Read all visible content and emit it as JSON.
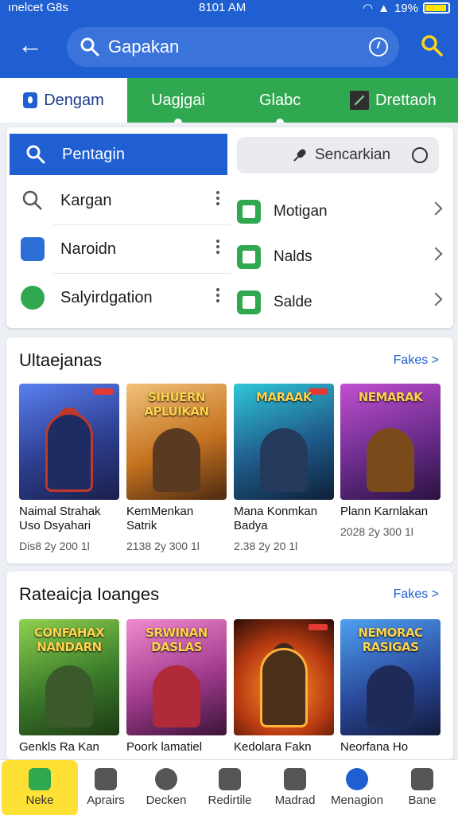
{
  "status_bar": {
    "carrier": "ınelcet G8s",
    "time": "8101 AM",
    "battery": "19%"
  },
  "header": {
    "search_placeholder": "Gapakan"
  },
  "tabs": [
    {
      "label": "Dengam"
    },
    {
      "label": "Uagjgai"
    },
    {
      "label": "Glabc"
    },
    {
      "label": "Drettaoh"
    }
  ],
  "quick": {
    "primary_label": "Pentagin",
    "secondary_label": "Sencarkian",
    "left_items": [
      {
        "label": "Kargan"
      },
      {
        "label": "Naroidn"
      },
      {
        "label": "Salyirdgation"
      }
    ],
    "right_items": [
      {
        "label": "Motigan"
      },
      {
        "label": "Nalds"
      },
      {
        "label": "Salde"
      }
    ]
  },
  "section1": {
    "title": "Ultaejanas",
    "more": "Fakes >",
    "cards": [
      {
        "logo": "",
        "name": "Naimal Strahak Uso Dsyahari",
        "meta": "Dis8 2y 200 1l"
      },
      {
        "logo": "SIHUERN APLUIKAN",
        "name": "KemMenkan Satrik",
        "meta": "2138 2y 300 1l"
      },
      {
        "logo": "MARAAK",
        "name": "Mana Konmkan Badya",
        "meta": "2.38 2y 20 1l"
      },
      {
        "logo": "NEMARAK",
        "name": "Plann Karnlakan",
        "meta": "2028 2y 300 1l"
      }
    ]
  },
  "section2": {
    "title": "Rateaicja Ioanges",
    "more": "Fakes >",
    "cards": [
      {
        "logo": "CONFAHAX NANDARN",
        "name": "Genkls Ra Kan"
      },
      {
        "logo": "SRWINAN DASLAS",
        "name": "Poork lamatiel"
      },
      {
        "logo": "",
        "name": "Kedolara Fakn"
      },
      {
        "logo": "NEMORAC RASIGAS",
        "name": "Neorfana Ho"
      }
    ]
  },
  "nav": [
    {
      "label": "Neke"
    },
    {
      "label": "Aprairs"
    },
    {
      "label": "Decken"
    },
    {
      "label": "Redirtile"
    },
    {
      "label": "Madrad"
    },
    {
      "label": "Menagion"
    },
    {
      "label": "Bane"
    }
  ],
  "colors": {
    "primary": "#1f5fd1",
    "green": "#2fa84f",
    "accent": "#ffe135"
  }
}
